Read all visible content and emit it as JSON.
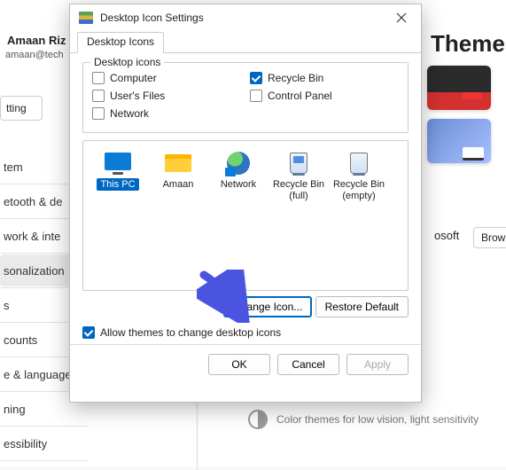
{
  "background": {
    "account_name": "Amaan Riz",
    "account_email": "amaan@tech",
    "search_text": "tting",
    "sidebar_items": [
      "tem",
      "etooth & de",
      "work & inte",
      "sonalization",
      "s",
      "counts",
      "e & language",
      "ning",
      "essibility"
    ],
    "selected_sidebar_index": 3,
    "page_title": "Themes",
    "ms_label": "osoft",
    "browse_label": "Brow",
    "contrast_text": "Color themes for low vision, light sensitivity"
  },
  "dialog": {
    "title": "Desktop Icon Settings",
    "tab_label": "Desktop Icons",
    "group_label": "Desktop icons",
    "checks": {
      "computer": {
        "label": "Computer",
        "checked": false
      },
      "users_files": {
        "label": "User's Files",
        "checked": false
      },
      "network": {
        "label": "Network",
        "checked": false
      },
      "recycle_bin": {
        "label": "Recycle Bin",
        "checked": true
      },
      "control_panel": {
        "label": "Control Panel",
        "checked": false
      }
    },
    "icons": [
      {
        "id": "this_pc",
        "label": "This PC",
        "selected": true,
        "icon": "monitor"
      },
      {
        "id": "amaan",
        "label": "Amaan",
        "selected": false,
        "icon": "folder"
      },
      {
        "id": "network",
        "label": "Network",
        "selected": false,
        "icon": "netglobe"
      },
      {
        "id": "rb_full",
        "label": "Recycle Bin (full)",
        "selected": false,
        "icon": "bin-full"
      },
      {
        "id": "rb_empty",
        "label": "Recycle Bin (empty)",
        "selected": false,
        "icon": "bin-empty"
      }
    ],
    "change_icon_label": "Change Icon...",
    "restore_default_label": "Restore Default",
    "allow_themes_label": "Allow themes to change desktop icons",
    "allow_themes_checked": true,
    "ok_label": "OK",
    "cancel_label": "Cancel",
    "apply_label": "Apply"
  },
  "annotation": {
    "arrow_color": "#4a54e1"
  }
}
